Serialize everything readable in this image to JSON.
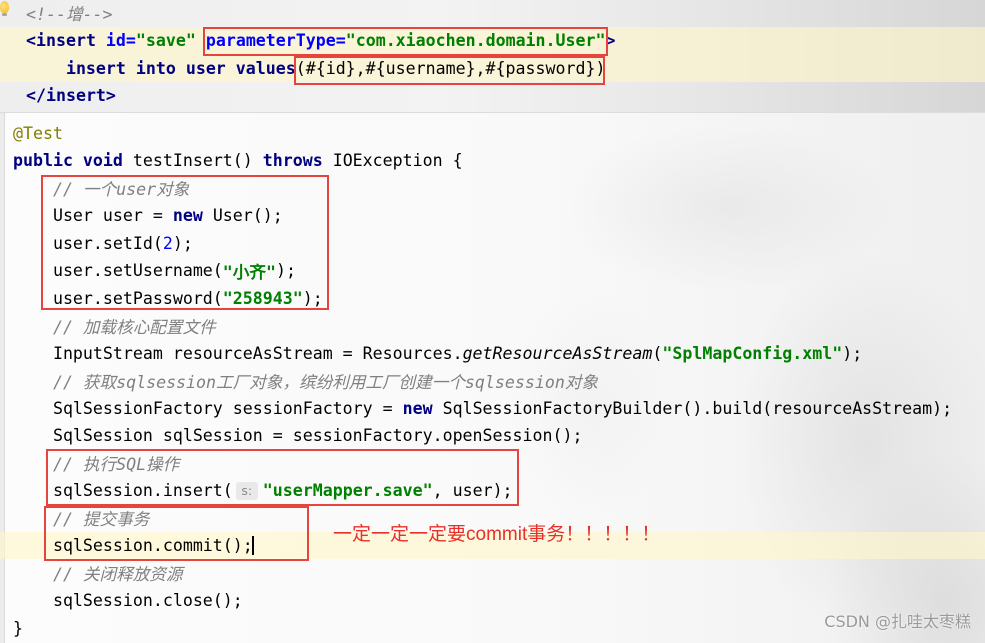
{
  "theme": {
    "keyword": "#000080",
    "string": "#008000",
    "comment": "#808080",
    "annotation": "#808000",
    "number": "#0000ff",
    "xml_tag": "#000080",
    "xml_attribute": "#0000ff",
    "highlight_box": "#e5443f",
    "note_text": "#e8302a",
    "caret_row": "#fff6c8"
  },
  "xml_editor": {
    "lines": [
      [
        "<!--增-->"
      ],
      [
        "<insert",
        " id=",
        "\"save\"",
        " ",
        "parameterType=",
        "\"com.xiaochen.domain.User\"",
        ">"
      ],
      [
        "insert into user values",
        "(#{id},#{username},#{password})"
      ],
      [
        "</insert>"
      ]
    ]
  },
  "java_editor": {
    "lines": [
      [
        "@Test"
      ],
      [
        "public void ",
        "testInsert() ",
        "throws ",
        "IOException {"
      ],
      [
        "// 一个user对象"
      ],
      [
        "User user = ",
        "new ",
        "User();"
      ],
      [
        "user.setId(",
        "2",
        ");"
      ],
      [
        "user.setUsername(",
        "\"小齐\"",
        ");"
      ],
      [
        "user.setPassword(",
        "\"258943\"",
        ");"
      ],
      [
        "// 加载核心配置文件"
      ],
      [
        "InputStream resourceAsStream = Resources.",
        "getResourceAsStream",
        "(",
        "\"SplMapConfig.xml\"",
        ");"
      ],
      [
        "// 获取sqlsession工厂对象，缤纷利用工厂创建一个sqlsession对象"
      ],
      [
        "SqlSessionFactory sessionFactory = ",
        "new ",
        "SqlSessionFactoryBuilder().build(resourceAsStream);"
      ],
      [
        "SqlSession sqlSession = sessionFactory.openSession();"
      ],
      [
        "// 执行SQL操作"
      ],
      [
        "sqlSession.insert(",
        "s:",
        "\"userMapper.save\"",
        ", user);"
      ],
      [
        "// 提交事务"
      ],
      [
        "sqlSession.commit();"
      ],
      [
        "// 关闭释放资源"
      ],
      [
        "sqlSession.close();"
      ],
      [
        "}"
      ]
    ]
  },
  "annotation_note": "一定一定一定要commit事务！！！！！",
  "watermark": "CSDN @扎哇太枣糕"
}
